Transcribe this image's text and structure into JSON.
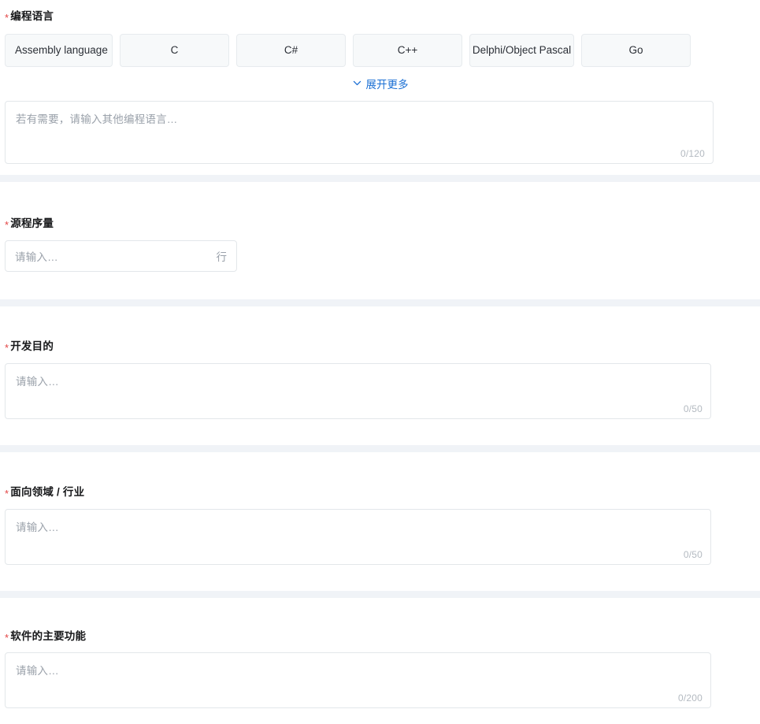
{
  "form": {
    "sections": [
      {
        "id": "programming-language",
        "label": "编程语言",
        "required_mark": "*",
        "chips": [
          {
            "label": "Assembly language"
          },
          {
            "label": "C"
          },
          {
            "label": "C#"
          },
          {
            "label": "C++"
          },
          {
            "label": "Delphi/Object Pascal"
          },
          {
            "label": "Go"
          }
        ],
        "expand": {
          "label": "展开更多",
          "icon": "chevron-down-icon"
        },
        "textarea": {
          "value": "",
          "placeholder": "若有需要，请输入其他编程语言…",
          "counter": "0/120",
          "maxlength": 120
        }
      },
      {
        "id": "source-code-lines",
        "label": "源程序量",
        "required_mark": "*",
        "input": {
          "value": "",
          "placeholder": "请输入…",
          "suffix": "行"
        }
      },
      {
        "id": "development-purpose",
        "label": "开发目的",
        "required_mark": "*",
        "textarea": {
          "value": "",
          "placeholder": "请输入…",
          "counter": "0/50",
          "maxlength": 50
        }
      },
      {
        "id": "target-field-industry",
        "label": "面向领域 / 行业",
        "required_mark": "*",
        "textarea": {
          "value": "",
          "placeholder": "请输入…",
          "counter": "0/50",
          "maxlength": 50
        }
      },
      {
        "id": "main-software-functions",
        "label": "软件的主要功能",
        "required_mark": "*",
        "textarea": {
          "value": "",
          "placeholder": "请输入…",
          "counter": "0/200",
          "maxlength": 200
        }
      }
    ]
  },
  "colors": {
    "required_star": "#e34545",
    "link": "#1a6fd4",
    "chip_bg": "#f7f9fa",
    "band": "#f0f3f7",
    "placeholder": "#9aa1aa",
    "border": "#e3e7ea"
  }
}
